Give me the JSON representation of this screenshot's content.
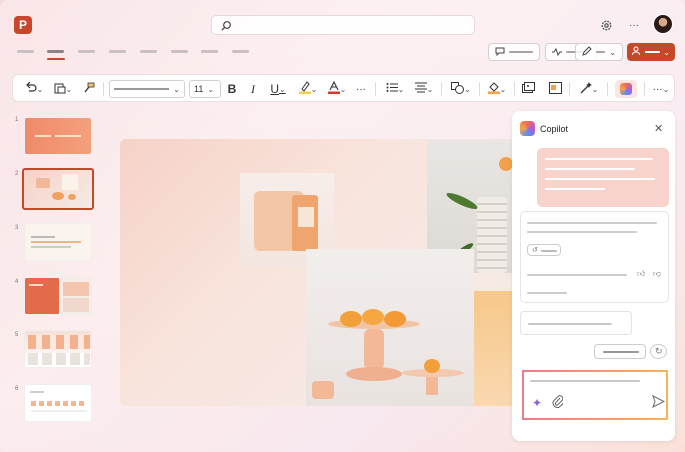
{
  "app": {
    "logo_letter": "P"
  },
  "toolbar": {
    "font_size": "11",
    "bold": "B",
    "italic": "I",
    "underline": "U",
    "more": "···"
  },
  "slides": [
    {
      "num": "1"
    },
    {
      "num": "2"
    },
    {
      "num": "3"
    },
    {
      "num": "4"
    },
    {
      "num": "5"
    },
    {
      "num": "6"
    }
  ],
  "copilot": {
    "title": "Copilot"
  },
  "colors": {
    "accent": "#c4492b",
    "highlight": "#f3d14a",
    "font_color": "#d83a2a"
  },
  "icons": [
    "search-icon",
    "settings-icon",
    "more-icon",
    "comment-icon",
    "record-icon",
    "edit-icon",
    "share-icon",
    "undo-icon",
    "paste-icon",
    "format-painter-icon",
    "bullets-icon",
    "align-icon",
    "shapes-icon",
    "fill-icon",
    "picture-icon",
    "designer-icon",
    "copilot-icon",
    "sparkle-icon",
    "attach-icon",
    "send-icon",
    "refresh-icon",
    "close-icon"
  ]
}
